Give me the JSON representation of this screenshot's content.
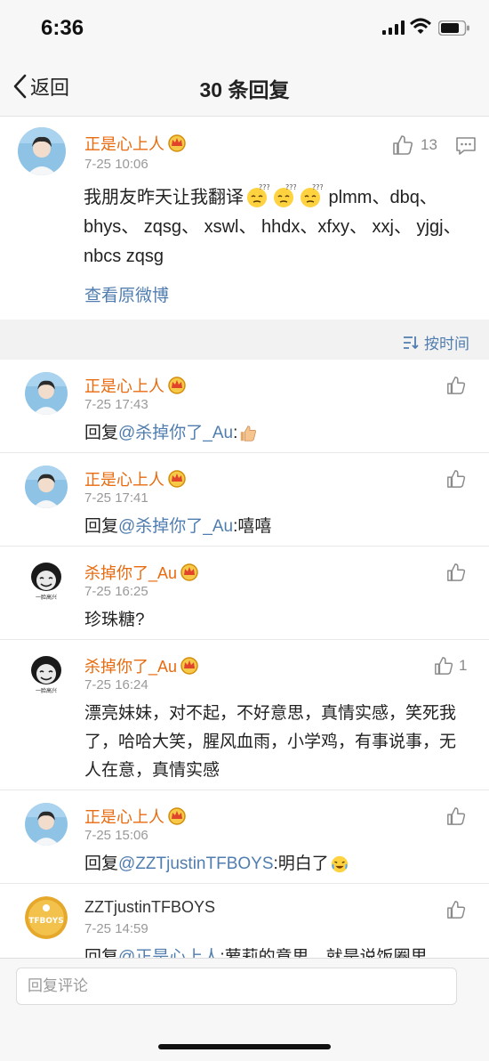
{
  "status_bar": {
    "time": "6:36"
  },
  "nav": {
    "back_label": "返回",
    "title": "30 条回复"
  },
  "main_post": {
    "user": "正是心上人",
    "time": "7-25 10:06",
    "text_prefix": "我朋友昨天让我翻译",
    "text_suffix": " plmm、dbq、 bhys、 zqsg、 xswl、 hhdx、xfxy、 xxj、 yjgj、 nbcs zqsg",
    "view_original": "查看原微博",
    "likes": "13"
  },
  "sort": {
    "label": "按时间"
  },
  "replies": [
    {
      "user": "正是心上人",
      "time": "7-25 17:43",
      "prefix": "回复",
      "mention": "@杀掉你了_Au",
      "text": ":",
      "likes": ""
    },
    {
      "user": "正是心上人",
      "time": "7-25 17:41",
      "prefix": "回复",
      "mention": "@杀掉你了_Au",
      "text": ":嘻嘻",
      "likes": ""
    },
    {
      "user": "杀掉你了_Au",
      "time": "7-25 16:25",
      "prefix": "",
      "mention": "",
      "text": "珍珠糖?",
      "likes": ""
    },
    {
      "user": "杀掉你了_Au",
      "time": "7-25 16:24",
      "prefix": "",
      "mention": "",
      "text": "漂亮妹妹，对不起，不好意思，真情实感，笑死我了，哈哈大笑，腥风血雨，小学鸡，有事说事，无人在意，真情实感",
      "likes": "1"
    },
    {
      "user": "正是心上人",
      "time": "7-25 15:06",
      "prefix": "回复",
      "mention": "@ZZTjustinTFBOYS",
      "text": ":明白了",
      "likes": ""
    },
    {
      "user": "ZZTjustinTFBOYS",
      "time": "7-25 14:59",
      "prefix": "回复",
      "mention": "@正是心上人",
      "text": ":萝莉的意思，就是说饭圈里",
      "likes": ""
    }
  ],
  "avatar_badges": {
    "meme_caption": "一脸高兴",
    "tfboys_logo": "TFBOYS"
  },
  "input": {
    "placeholder": "回复评论"
  },
  "colors": {
    "username": "#e86b10",
    "link": "#507daf",
    "timestamp": "#999999"
  }
}
